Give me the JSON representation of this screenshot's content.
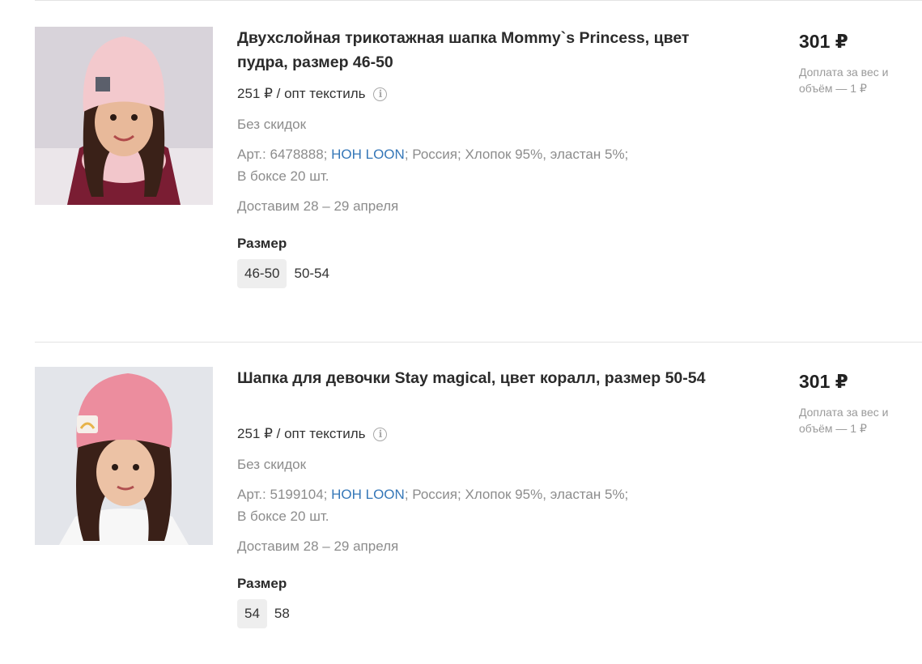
{
  "products": [
    {
      "title": "Двухслойная трикотажная шапка Mommy`s Princess, цвет пудра, размер 46-50",
      "opt_price": "251 ₽ / опт текстиль",
      "discount": "Без скидок",
      "details_prefix": "Арт.: 6478888; ",
      "brand": "HOH LOON",
      "details_suffix": "; Россия; Хлопок 95%, эластан 5%;",
      "box": "В боксе 20 шт.",
      "delivery": "Доставим 28 – 29 апреля",
      "size_label": "Размер",
      "sizes": [
        "46-50",
        "50-54"
      ],
      "selected_size": "46-50",
      "price": "301 ₽",
      "surcharge": "Доплата за вес и объём — 1 ₽",
      "hat_color": "#f3c9cd",
      "bg_color": "#d8d3da"
    },
    {
      "title": "Шапка для девочки Stay magical, цвет коралл, размер 50-54",
      "opt_price": "251 ₽ / опт текстиль",
      "discount": "Без скидок",
      "details_prefix": "Арт.: 5199104; ",
      "brand": "HOH LOON",
      "details_suffix": "; Россия; Хлопок 95%, эластан 5%;",
      "box": "В боксе 20 шт.",
      "delivery": "Доставим 28 – 29 апреля",
      "size_label": "Размер",
      "sizes": [
        "54",
        "58"
      ],
      "selected_size": "54",
      "price": "301 ₽",
      "surcharge": "Доплата за вес и объём — 1 ₽",
      "hat_color": "#ec8d9e",
      "bg_color": "#e3e5ea"
    }
  ],
  "colors": {
    "link": "#3577b8",
    "muted": "#8c8c8c",
    "chip_bg": "#eeeeee"
  }
}
